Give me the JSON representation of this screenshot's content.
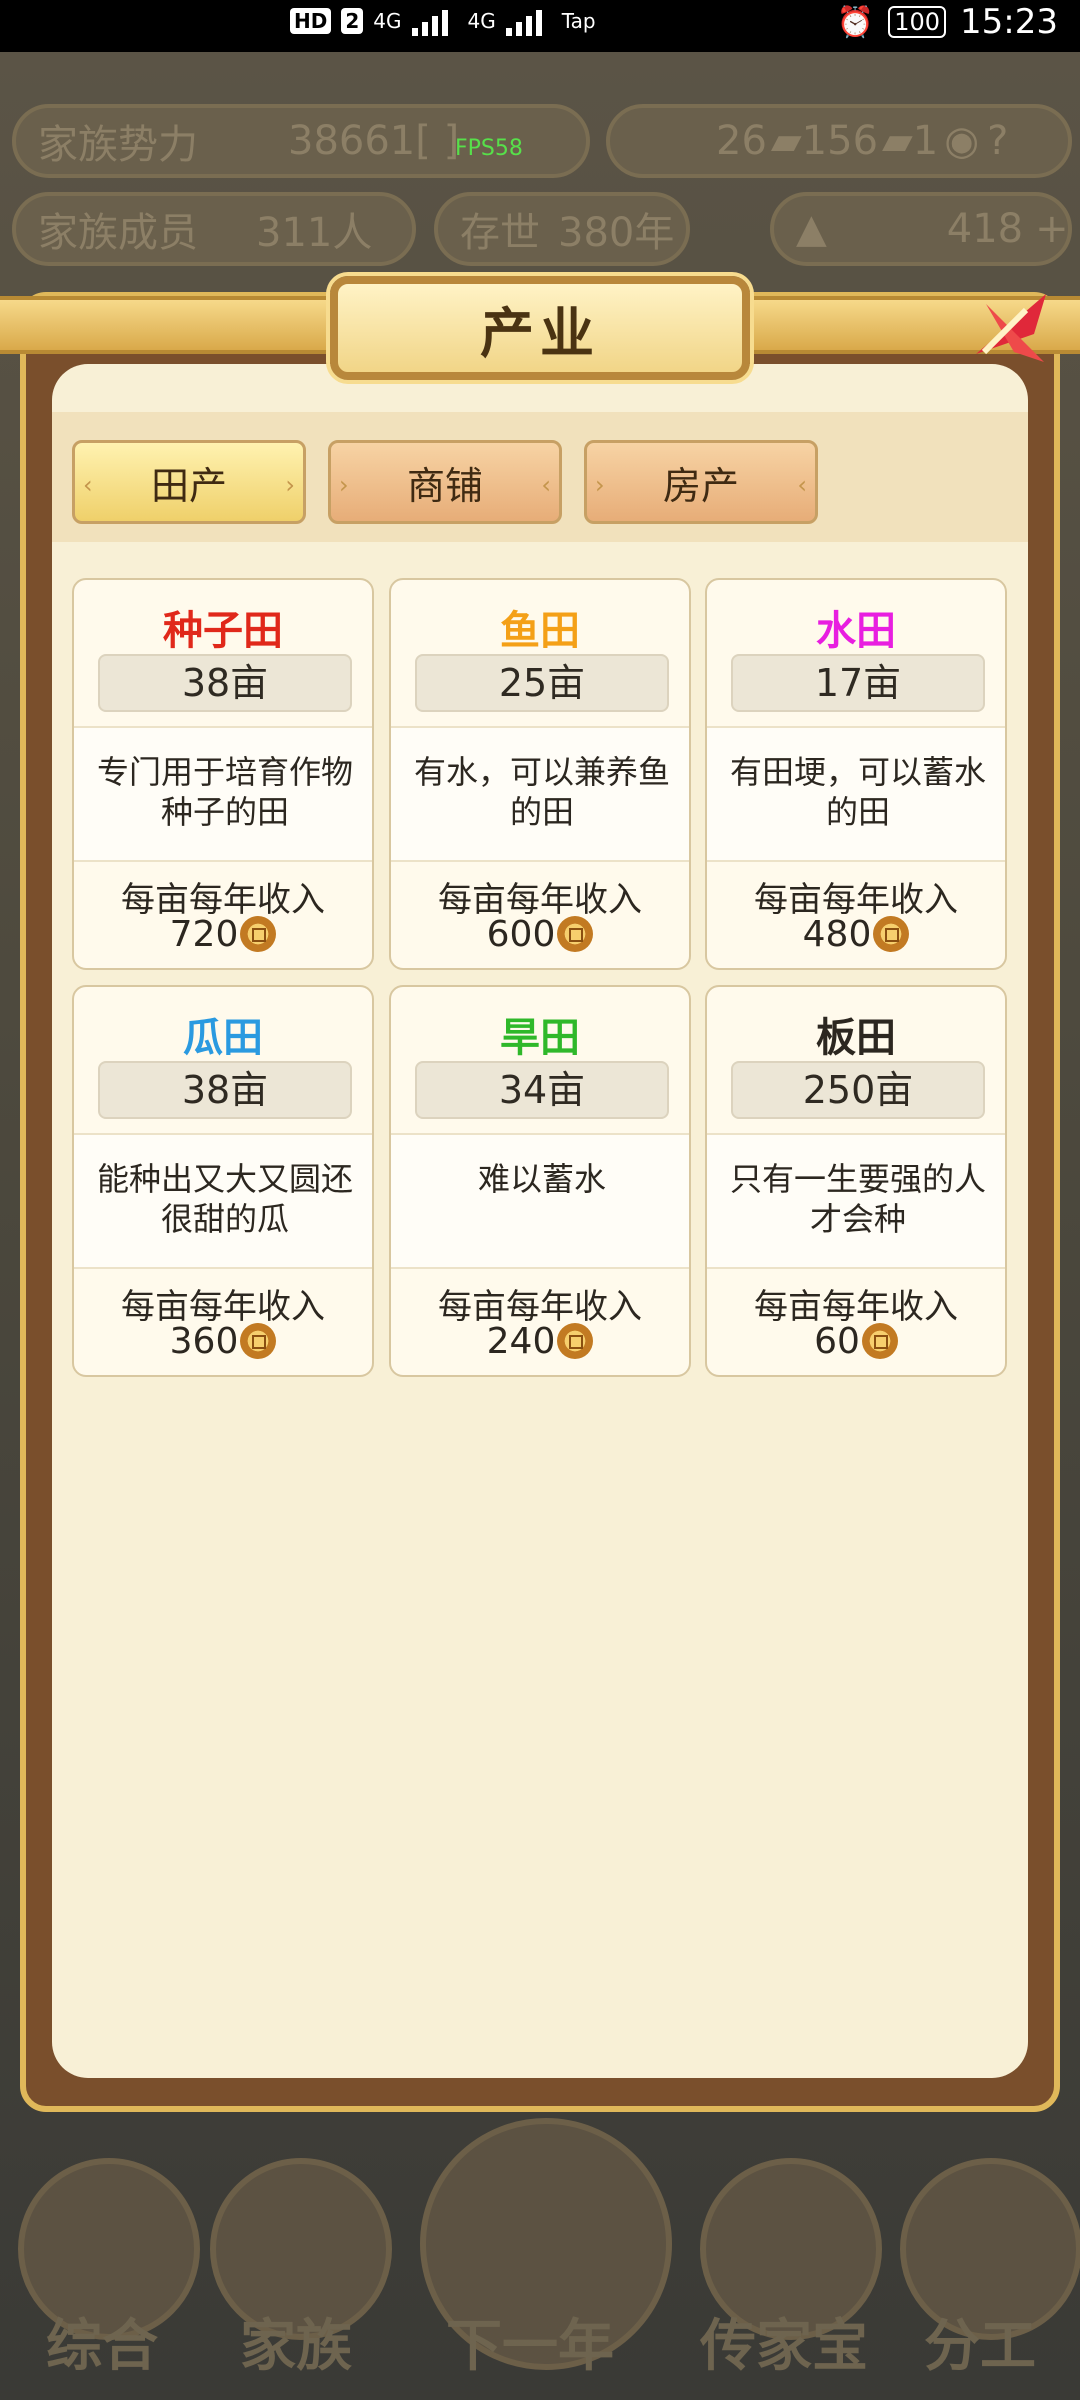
{
  "status_bar": {
    "hd": "HD",
    "sim": "2",
    "net1": "4G",
    "net2": "4G",
    "app": "Tap",
    "battery": "100",
    "time": "15:23"
  },
  "hud": {
    "power_label": "家族势力",
    "power_value": "38661",
    "power_bracket": "[     ]",
    "fps": "FPS58",
    "gold_count": "26",
    "silver_count": "156",
    "coin_count": "1",
    "help_icon": "question-icon",
    "members_label": "家族成员",
    "members_value": "311人",
    "exist_label": "存世",
    "exist_value": "380年",
    "ingot_value": "418",
    "add_icon": "plus-icon"
  },
  "panel": {
    "title": "产业",
    "tabs": [
      {
        "label": "田产",
        "active": true
      },
      {
        "label": "商铺",
        "active": false
      },
      {
        "label": "房产",
        "active": false
      }
    ],
    "income_label": "每亩每年收入",
    "fields": [
      {
        "name": "种子田",
        "color": "#e0281a",
        "area": "38亩",
        "desc": "专门用于培育作物种子的田",
        "income": "720"
      },
      {
        "name": "鱼田",
        "color": "#f4a017",
        "area": "25亩",
        "desc": "有水，可以兼养鱼的田",
        "income": "600"
      },
      {
        "name": "水田",
        "color": "#e81ee0",
        "area": "17亩",
        "desc": "有田埂，可以蓄水的田",
        "income": "480"
      },
      {
        "name": "瓜田",
        "color": "#2a9ae0",
        "area": "38亩",
        "desc": "能种出又大又圆还很甜的瓜",
        "income": "360"
      },
      {
        "name": "旱田",
        "color": "#2fb82a",
        "area": "34亩",
        "desc": "难以蓄水",
        "income": "240"
      },
      {
        "name": "板田",
        "color": "#2c2720",
        "area": "250亩",
        "desc": "只有一生要强的人才会种",
        "income": "60"
      }
    ]
  },
  "bottom_nav": [
    "综合",
    "家族",
    "下一年",
    "传家宝",
    "分工"
  ]
}
